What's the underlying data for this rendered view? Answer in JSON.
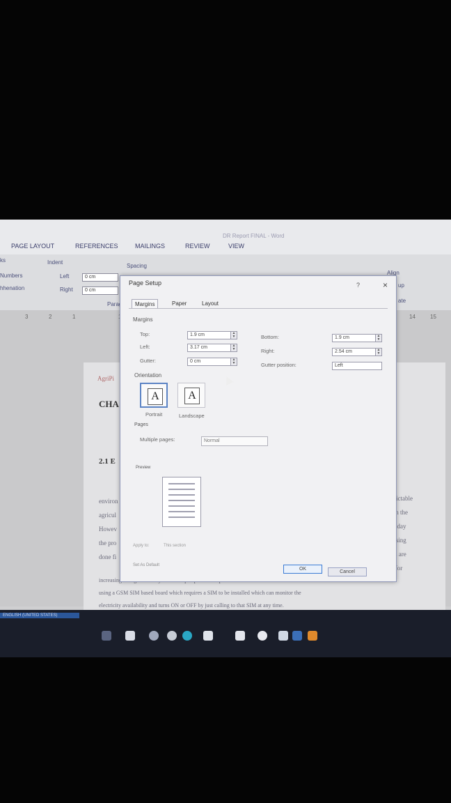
{
  "window": {
    "title": "DR Report FINAL - Word"
  },
  "ribbon": {
    "tabs": [
      "PAGE LAYOUT",
      "REFERENCES",
      "MAILINGS",
      "REVIEW",
      "VIEW"
    ],
    "breaks_partial": "ks",
    "line_numbers": "Numbers",
    "hyphenation": "hhenation",
    "indent_label": "Indent",
    "spacing_label": "Spacing",
    "indent_left_label": "Left",
    "indent_right_label": "Right",
    "indent_left_value": "0 cm",
    "indent_right_value": "0 cm",
    "paragraph_group": "Parag",
    "align_label": "Align",
    "up_partial": "up",
    "ate_partial": "ate"
  },
  "ruler": {
    "marks": [
      "3",
      "2",
      "1",
      "1",
      "14",
      "15"
    ]
  },
  "document": {
    "header_text": "AgriPi",
    "chapter": "CHA",
    "section": "2.1 E",
    "left_fragments": [
      "environ",
      "agricul",
      "Howev",
      "the pro",
      "done fi"
    ],
    "right_fragments": [
      "unpredictable",
      "earch in the",
      "day by day",
      "n increasing",
      "attempts are",
      "helpful for"
    ],
    "line_8": "increasing the agricultural yield. To cope up with this problem one new model was",
    "line_9": "using a GSM SIM based board which requires a SIM to be installed which can monitor the",
    "line_10": "electricity availability and turns ON or OFF by just calling to that SIM at any time."
  },
  "dialog": {
    "title": "Page Setup",
    "help": "?",
    "close": "×",
    "tabs": [
      "Margins",
      "Paper",
      "Layout"
    ],
    "margins_section": "Margins",
    "top_label": "Top:",
    "top_value": "1.9 cm",
    "bottom_label": "Bottom:",
    "bottom_value": "1.9 cm",
    "left_label": "Left:",
    "left_value": "3.17 cm",
    "right_label": "Right:",
    "right_value": "2.54 cm",
    "gutter_label": "Gutter:",
    "gutter_value": "0 cm",
    "gutter_position_label": "Gutter position:",
    "gutter_position_value": "Left",
    "orientation_section": "Orientation",
    "portrait_label": "Portrait",
    "landscape_label": "Landscape",
    "pages_section": "Pages",
    "multiple_pages_label": "Multiple pages:",
    "multiple_pages_value": "Normal",
    "preview_section": "Preview",
    "apply_to_label": "Apply to:",
    "apply_to_value": "This section",
    "set_default_label": "Set As Default",
    "ok_label": "OK",
    "cancel_label": "Cancel"
  },
  "taskbar": {
    "status_text": "ENGLISH (UNITED STATES)"
  },
  "colors": {
    "accent": "#3a7bd5",
    "taskbar": "#1a1e2a",
    "dialog_bg": "#f1f1f3"
  }
}
